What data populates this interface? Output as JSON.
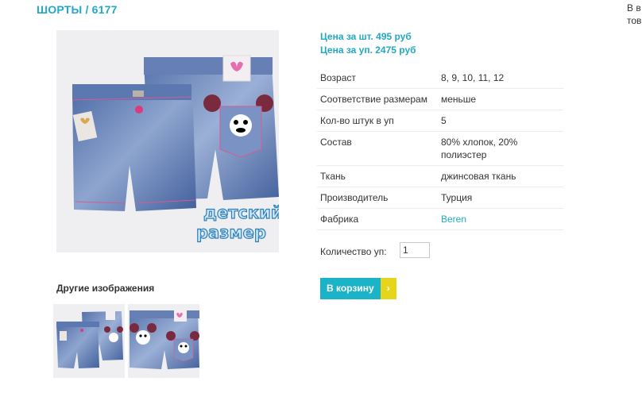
{
  "product": {
    "title": "ШОРТЫ / 6177",
    "price_unit": "Цена за шт. 495 руб",
    "price_pack": "Цена за уп. 2475 руб"
  },
  "corner_text": [
    "В в",
    "тов"
  ],
  "specs": [
    {
      "label": "Возраст",
      "value": "8, 9, 10, 11, 12"
    },
    {
      "label": "Соответствие размерам",
      "value": "меньше"
    },
    {
      "label": "Кол-во штук в уп",
      "value": "5"
    },
    {
      "label": "Состав",
      "value": "80% хлопок, 20% полиэстер"
    },
    {
      "label": "Ткань",
      "value": "джинсовая ткань"
    },
    {
      "label": "Производитель",
      "value": "Турция"
    },
    {
      "label": "Фабрика",
      "value": "Beren"
    }
  ],
  "quantity": {
    "label": "Количество уп:",
    "value": "1"
  },
  "cart_button": {
    "label": "В корзину",
    "arrow": "›"
  },
  "other_images": {
    "label": "Другие изображения"
  },
  "watermark": {
    "line1": "детский",
    "line2": "размер"
  },
  "colors": {
    "accent": "#22a8c2",
    "button": "#1ab3c8",
    "arrow": "#e6d51a",
    "denim": "#5a78ad"
  }
}
